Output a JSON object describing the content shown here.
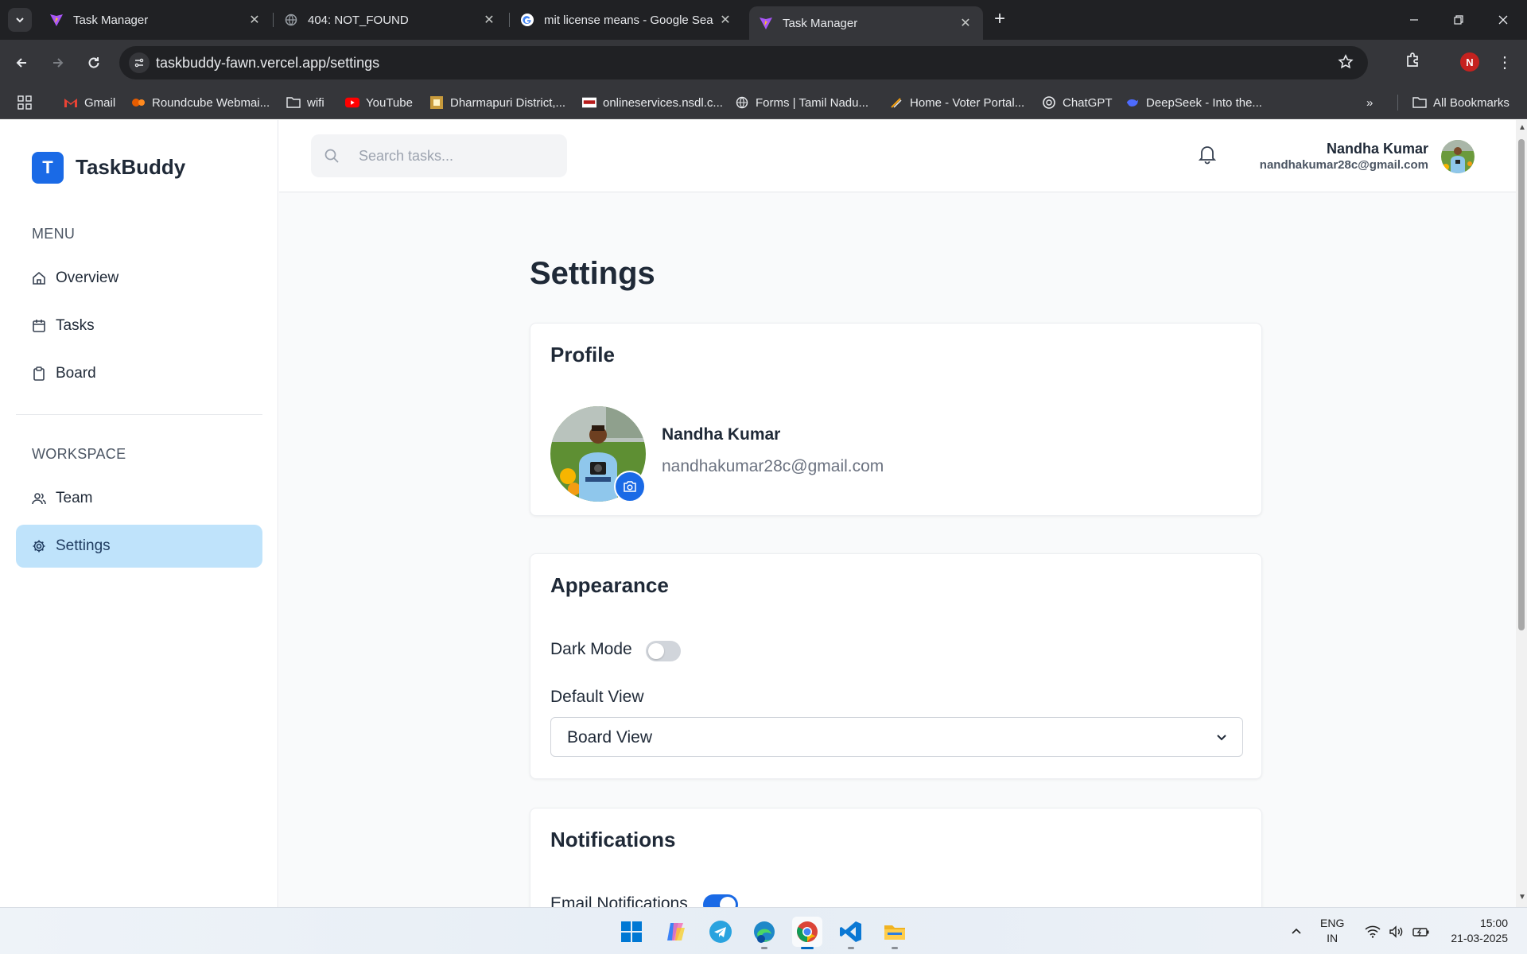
{
  "browser": {
    "tabs": [
      {
        "title": "Task Manager",
        "active": false
      },
      {
        "title": "404: NOT_FOUND",
        "active": false
      },
      {
        "title": "mit license means - Google Sea",
        "active": false
      },
      {
        "title": "Task Manager",
        "active": true
      }
    ],
    "url_host": "taskbuddy-fawn.vercel.app",
    "url_path": "/settings",
    "profile_initial": "N",
    "bookmarks": [
      {
        "label": "Gmail",
        "icon": "gmail-icon"
      },
      {
        "label": "Roundcube Webmai...",
        "icon": "roundcube-icon"
      },
      {
        "label": "wifi",
        "icon": "folder-icon"
      },
      {
        "label": "YouTube",
        "icon": "youtube-icon"
      },
      {
        "label": "Dharmapuri District,...",
        "icon": "district-icon"
      },
      {
        "label": "onlineservices.nsdl.c...",
        "icon": "nsdl-icon"
      },
      {
        "label": "Forms | Tamil Nadu...",
        "icon": "globe-icon"
      },
      {
        "label": "Home - Voter Portal...",
        "icon": "voter-icon"
      },
      {
        "label": "ChatGPT",
        "icon": "chatgpt-icon"
      },
      {
        "label": "DeepSeek - Into the...",
        "icon": "deepseek-icon"
      }
    ],
    "all_bookmarks": "All Bookmarks"
  },
  "app": {
    "brand_initial": "T",
    "brand": "TaskBuddy",
    "menu_label": "MENU",
    "menu": [
      {
        "label": "Overview",
        "icon": "home-icon"
      },
      {
        "label": "Tasks",
        "icon": "calendar-icon"
      },
      {
        "label": "Board",
        "icon": "clipboard-icon"
      }
    ],
    "workspace_label": "WORKSPACE",
    "workspace": [
      {
        "label": "Team",
        "icon": "users-icon",
        "active": false
      },
      {
        "label": "Settings",
        "icon": "gear-icon",
        "active": true
      }
    ],
    "search_placeholder": "Search tasks...",
    "user": {
      "name": "Nandha Kumar",
      "email": "nandhakumar28c@gmail.com"
    }
  },
  "settings": {
    "title": "Settings",
    "profile": {
      "heading": "Profile",
      "name": "Nandha Kumar",
      "email": "nandhakumar28c@gmail.com"
    },
    "appearance": {
      "heading": "Appearance",
      "dark_mode_label": "Dark Mode",
      "dark_mode_on": false,
      "default_view_label": "Default View",
      "default_view_value": "Board View"
    },
    "notifications": {
      "heading": "Notifications",
      "email_label": "Email Notifications",
      "email_on": true
    }
  },
  "taskbar": {
    "apps": [
      "windows-start-icon",
      "copilot-icon",
      "telegram-icon",
      "edge-icon",
      "chrome-icon",
      "vscode-icon",
      "file-explorer-icon"
    ],
    "lang_line1": "ENG",
    "lang_line2": "IN",
    "time": "15:00",
    "date": "21-03-2025"
  },
  "colors": {
    "accent": "#1a6ae6",
    "active_nav_bg": "#bfe3fb",
    "chrome_dark": "#202124",
    "chrome_mid": "#35363a"
  }
}
